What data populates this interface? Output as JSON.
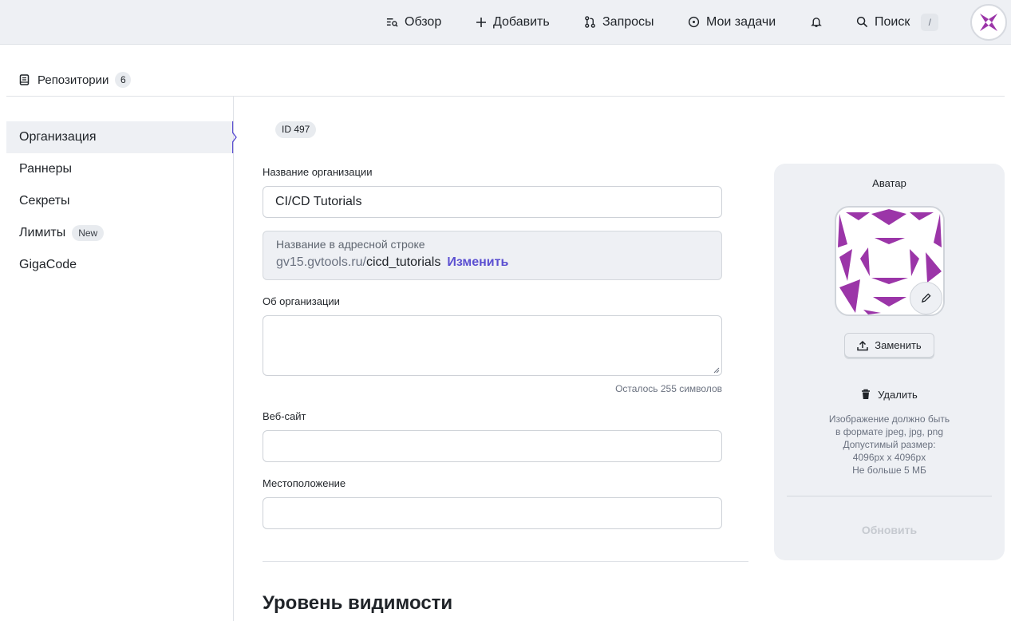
{
  "topbar": {
    "overview": "Обзор",
    "add": "Добавить",
    "requests": "Запросы",
    "my_tasks": "Мои задачи",
    "search": "Поиск",
    "search_shortcut": "/"
  },
  "repo": {
    "label": "Репозитории",
    "count": "6"
  },
  "sidebar": {
    "items": [
      {
        "label": "Организация"
      },
      {
        "label": "Раннеры"
      },
      {
        "label": "Секреты"
      },
      {
        "label": "Лимиты",
        "badge": "New"
      },
      {
        "label": "GigaCode"
      }
    ]
  },
  "form": {
    "id_badge": "ID 497",
    "org_name_label": "Название организации",
    "org_name_value": "CI/CD Tutorials",
    "slug_label": "Название в адресной строке",
    "slug_host": "gv15.gvtools.ru/",
    "slug_value": "cicd_tutorials",
    "slug_change": "Изменить",
    "about_label": "Об организации",
    "about_value": "",
    "chars_left": "Осталось 255 символов",
    "website_label": "Веб-сайт",
    "website_value": "",
    "location_label": "Местоположение",
    "location_value": "",
    "visibility_title": "Уровень видимости"
  },
  "avatar_card": {
    "title": "Аватар",
    "replace": "Заменить",
    "delete": "Удалить",
    "hint_lines": [
      "Изображение должно быть",
      "в формате jpeg, jpg, png",
      "Допустимый размер:",
      "4096px x 4096px",
      "Не больше 5 МБ"
    ],
    "update": "Обновить"
  },
  "colors": {
    "accent": "#5b4fd1",
    "avatar_purple": "#9b35a8",
    "topbar_bg": "#eef0f4"
  },
  "icons": {
    "overview": "overview-icon",
    "add": "plus-icon",
    "requests": "pull-request-icon",
    "tasks": "task-circle-icon",
    "notifications": "bell-icon",
    "search": "search-icon",
    "repo": "repository-icon",
    "edit": "pencil-icon",
    "upload": "upload-icon",
    "delete": "trash-icon"
  }
}
